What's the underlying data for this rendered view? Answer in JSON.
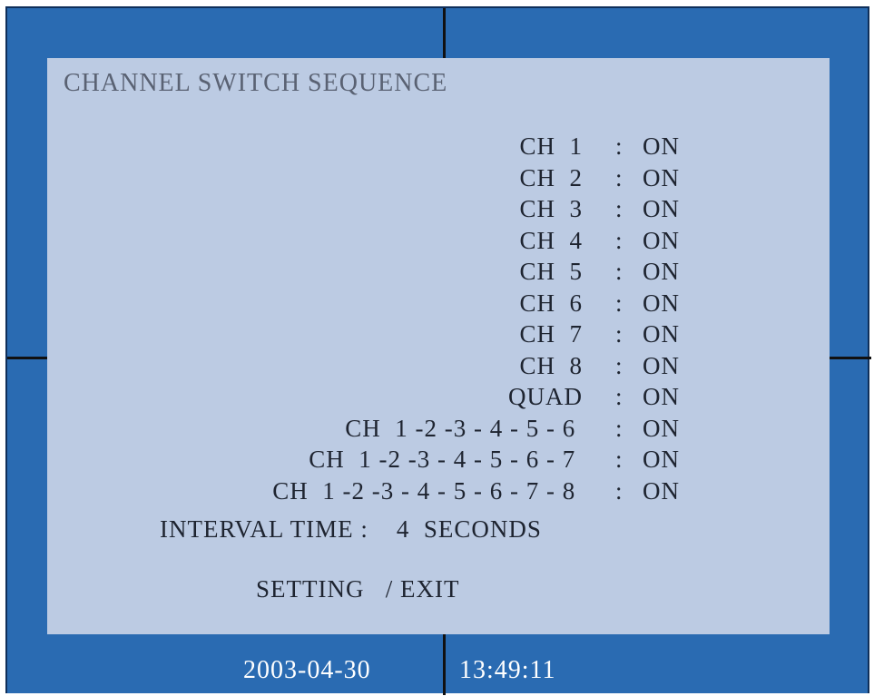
{
  "menu": {
    "title": "CHANNEL SWITCH SEQUENCE",
    "channels": [
      {
        "label": "CH  1",
        "colon": ":",
        "value": "ON"
      },
      {
        "label": "CH  2",
        "colon": ":",
        "value": "ON"
      },
      {
        "label": "CH  3",
        "colon": ":",
        "value": "ON"
      },
      {
        "label": "CH  4",
        "colon": ":",
        "value": "ON"
      },
      {
        "label": "CH  5",
        "colon": ":",
        "value": "ON"
      },
      {
        "label": "CH  6",
        "colon": ":",
        "value": "ON"
      },
      {
        "label": "CH  7",
        "colon": ":",
        "value": "ON"
      },
      {
        "label": "CH  8",
        "colon": ":",
        "value": "ON"
      },
      {
        "label": "QUAD",
        "colon": ":",
        "value": "ON"
      },
      {
        "label": "CH  1 -2 -3 - 4 - 5 - 6 ",
        "colon": ":",
        "value": "ON"
      },
      {
        "label": "CH  1 -2 -3 - 4 - 5 - 6 - 7 ",
        "colon": ":",
        "value": "ON"
      },
      {
        "label": "CH  1 -2 -3 - 4 - 5 - 6 - 7 - 8 ",
        "colon": ":",
        "value": "ON"
      }
    ],
    "interval_label": "INTERVAL TIME :",
    "interval_value": "4",
    "interval_unit": "SECONDS",
    "setting_label": "SETTING",
    "exit_separator": "/",
    "exit_label": "EXIT"
  },
  "status": {
    "date": "2003-04-30",
    "time": "13:49:11"
  },
  "colors": {
    "background": "#2a6bb2",
    "panel": "#bccbe3",
    "text": "#1e2430",
    "title_text": "#5a6273",
    "status_text": "#ffffff"
  }
}
